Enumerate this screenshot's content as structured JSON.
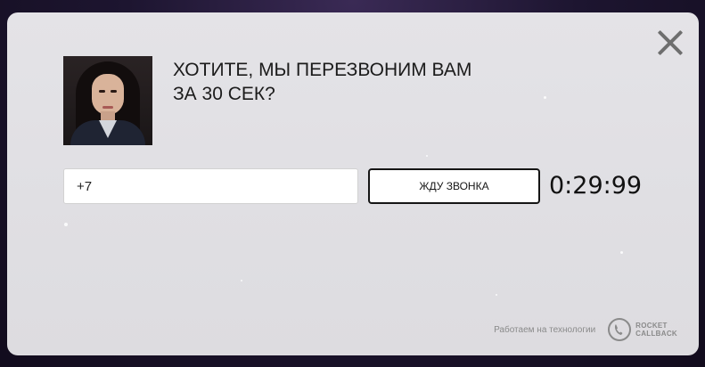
{
  "popup": {
    "headline_line1": "ХОТИТЕ, МЫ ПЕРЕЗВОНИМ ВАМ",
    "headline_line2": "ЗА 30 СЕК?",
    "phone_value": "+7",
    "wait_button_label": "ЖДУ ЗВОНКА",
    "timer": "0:29:99"
  },
  "footer": {
    "powered_by": "Работаем на технологии",
    "brand_line1": "ROCKET",
    "brand_line2": "CALLBACK"
  },
  "icons": {
    "close": "close-icon",
    "brand": "phone-icon"
  },
  "colors": {
    "modal_background": "#e2e1e5",
    "button_border": "#151515",
    "muted_text": "#8a8a8a"
  }
}
